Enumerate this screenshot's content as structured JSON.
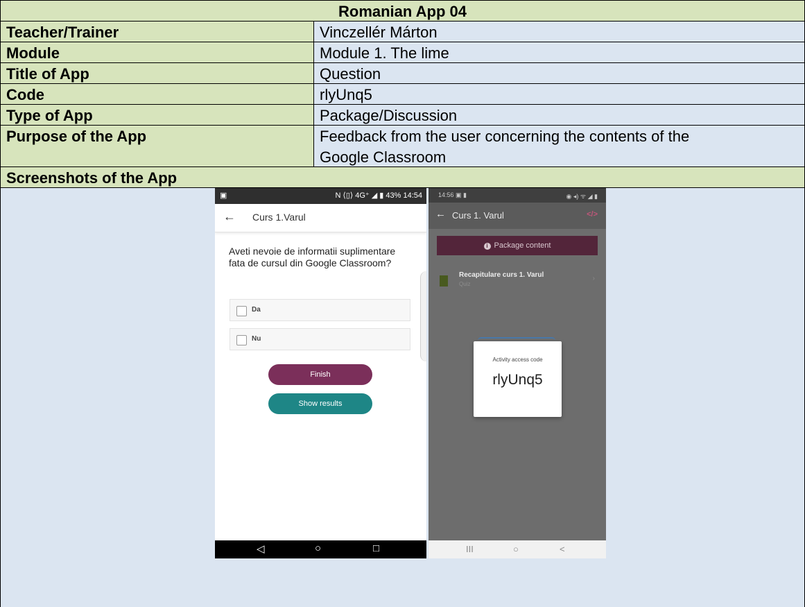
{
  "header": "Romanian App 04",
  "rows": [
    {
      "label": "Teacher/Trainer",
      "value": "Vinczellér Márton"
    },
    {
      "label": "Module",
      "value": "Module 1. The lime"
    },
    {
      "label": "Title of App",
      "value": "Question"
    },
    {
      "label": "Code",
      "value": "rlyUnq5"
    },
    {
      "label": "Type of App",
      "value": "Package/Discussion"
    },
    {
      "label": "Purpose of the App",
      "value_line1": "Feedback from the user concerning the contents of the",
      "value_line2": "Google Classroom"
    }
  ],
  "screenshots_label": "Screenshots of the App",
  "phone1": {
    "status_right": "N ⟨▯⟩ 4G⁺ ◢ ▮ 43%  14:54",
    "back_icon": "←",
    "title": "Curs 1.Varul",
    "question": "Aveti nevoie de informatii suplimentare fata de cursul din Google Classroom?",
    "options": [
      "Da",
      "Nu"
    ],
    "finish_label": "Finish",
    "show_results_label": "Show results",
    "nav": [
      "◁",
      "○",
      "□"
    ],
    "colors": {
      "finish": "#7b2f5a",
      "show_results": "#1e8686"
    }
  },
  "phone2": {
    "status_left": "14:56 ▣ ▮",
    "status_right": "◉ ◂) ᯤ ◢ ▮",
    "back_icon": "←",
    "title": "Curs 1. Varul",
    "code_icon": "</>",
    "package_label": "Package content",
    "item_title": "Recapitulare curs 1. Varul",
    "item_sub": "Quiz",
    "item_chevron": "›",
    "dialog_title": "Activity access code",
    "dialog_code": "rlyUnq5",
    "nav": [
      "III",
      "○",
      "<"
    ]
  }
}
